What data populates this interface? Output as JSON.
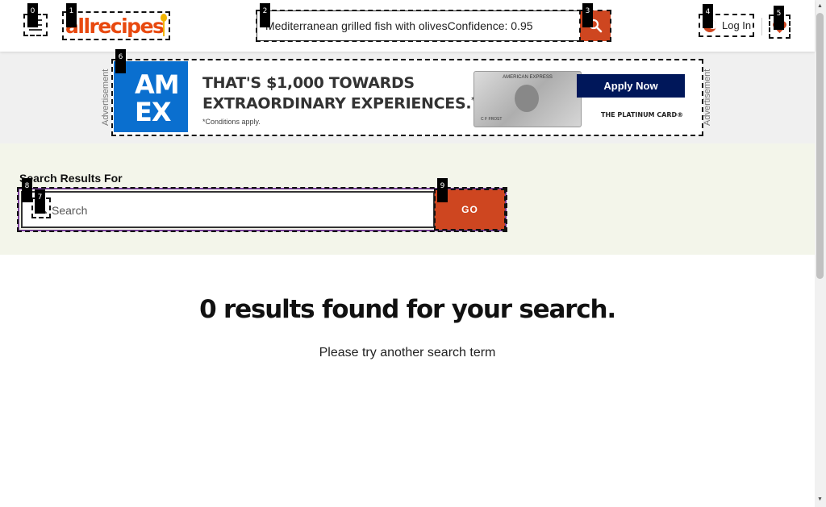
{
  "header": {
    "logo_text": "allrecipes",
    "search_value": "Mediterranean grilled fish with olivesConfidence: 0.95",
    "login_label": "Log In"
  },
  "ad": {
    "side_label": "Advertisement",
    "logo_line1": "AM",
    "logo_line2": "EX",
    "headline_line1": "THAT'S $1,000 TOWARDS",
    "headline_line2": "EXTRAORDINARY EXPERIENCES.",
    "headline_mark": "*",
    "conditions": "*Conditions apply.",
    "card_brand": "AMERICAN EXPRESS",
    "card_name": "C F FROST",
    "cta": "Apply Now",
    "product": "THE PLATINUM CARD®"
  },
  "results": {
    "label": "Search Results For",
    "placeholder": "Search",
    "go_label": "GO",
    "heading": "0 results found for your search.",
    "subtext": "Please try another search term"
  },
  "labels": [
    "0",
    "1",
    "2",
    "3",
    "4",
    "5",
    "6",
    "7",
    "8",
    "9"
  ],
  "colors": {
    "brand": "#e8490f",
    "button": "#ce4620",
    "band": "#f3f5ea",
    "ad_blue": "#00175a"
  }
}
